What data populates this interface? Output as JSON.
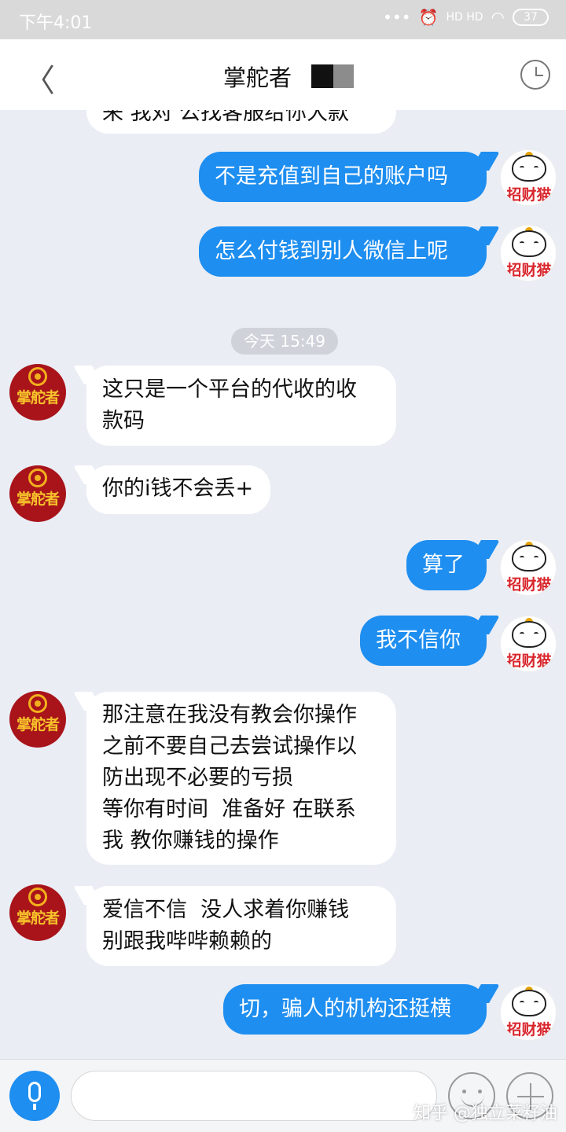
{
  "status_bar": {
    "time": "下午4:01",
    "signal_indicators": "HD HD",
    "battery": "37"
  },
  "header": {
    "back_glyph": "〈",
    "title": "掌舵者"
  },
  "messages": {
    "partial_top": "来 我对 公找客服给你大款",
    "m1": "不是充值到自己的账户吗",
    "m2": "怎么付钱到别人微信上呢",
    "timestamp": "今天 15:49",
    "m3_line1": "这只是一个平台的代收的收",
    "m3_line2": "款码",
    "m4": "你的i钱不会丢+",
    "m5": "算了",
    "m6": "我不信你",
    "m7_line1": "那注意在我没有教会你操作",
    "m7_line2": "之前不要自己去尝试操作以",
    "m7_line3": "防出现不必要的亏损",
    "m7_line4": "等你有时间  准备好 在联系",
    "m7_line5": "我 教你赚钱的操作",
    "m8_line1": "爱信不信  没人求着你赚钱",
    "m8_line2": "别跟我哔哔赖赖的",
    "m9": "切，骗人的机构还挺横"
  },
  "avatars": {
    "incoming_label": "掌舵者",
    "outgoing_label": "招财猫"
  },
  "input": {
    "placeholder": ""
  },
  "watermark": "知乎 @独立菜籽油",
  "colors": {
    "chat_background": "#eaedf4",
    "outgoing_bubble": "#1e8ef0",
    "incoming_bubble": "#ffffff",
    "incoming_avatar": "#a8141a"
  }
}
